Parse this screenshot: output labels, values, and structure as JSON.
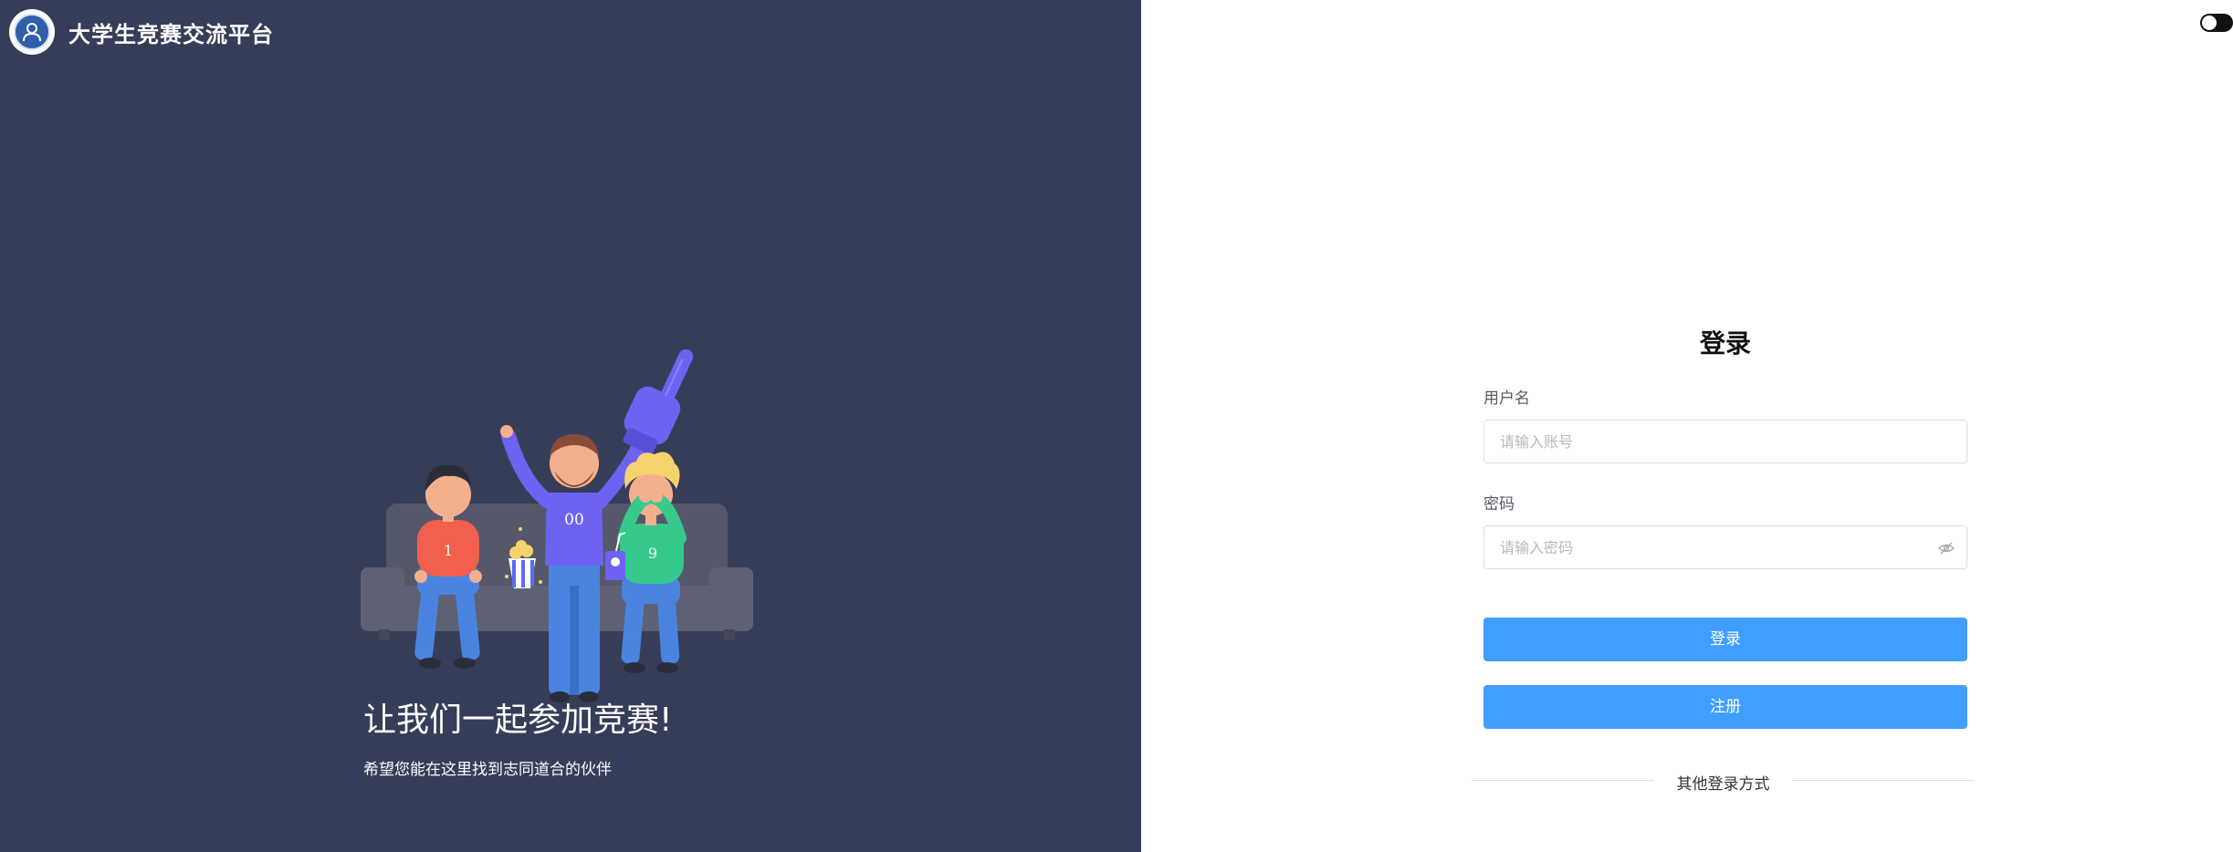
{
  "brand": {
    "title": "大学生竞赛交流平台",
    "logo_icon": "user-group-icon"
  },
  "hero": {
    "slogan": "让我们一起参加竞赛!",
    "subtitle": "希望您能在这里找到志同道合的伙伴",
    "jersey_numbers": [
      "1",
      "00",
      "9"
    ]
  },
  "login": {
    "title": "登录",
    "username_label": "用户名",
    "username_placeholder": "请输入账号",
    "password_label": "密码",
    "password_placeholder": "请输入密码",
    "login_button": "登录",
    "register_button": "注册",
    "other_methods": "其他登录方式"
  },
  "colors": {
    "panel_bg": "#363d58",
    "primary": "#409eff"
  }
}
